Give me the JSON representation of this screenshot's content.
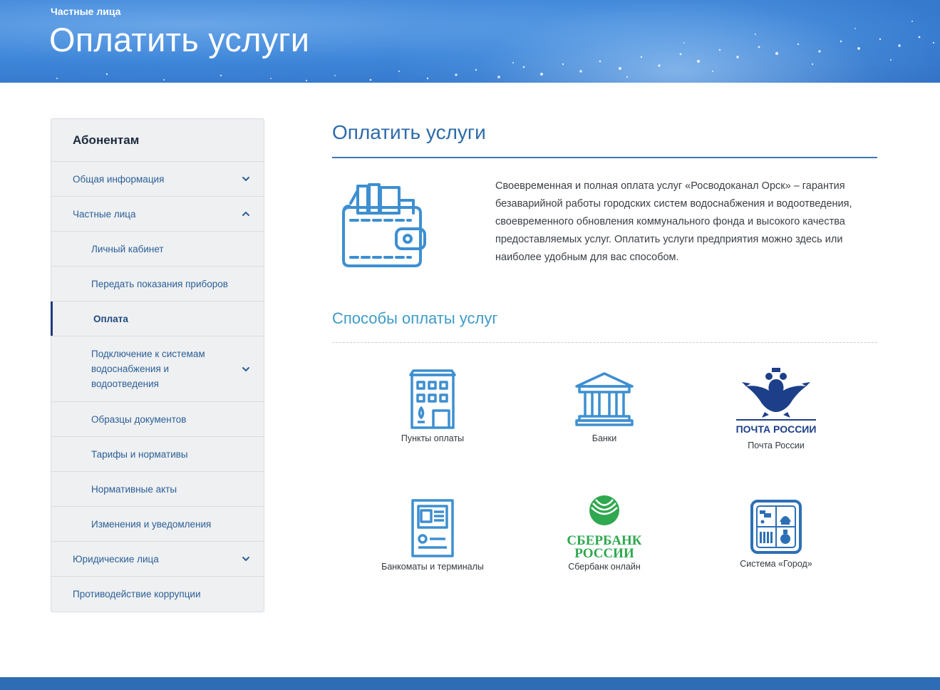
{
  "header": {
    "breadcrumb": "Частные лица",
    "title": "Оплатить услуги"
  },
  "sidebar": {
    "heading": "Абонентам",
    "items": [
      {
        "label": "Общая информация",
        "icon": "chevron-down-icon"
      },
      {
        "label": "Частные лица",
        "icon": "chevron-up-icon"
      },
      {
        "label": "Личный кабинет"
      },
      {
        "label": "Передать показания приборов"
      },
      {
        "label": "Оплата"
      },
      {
        "label": "Подключение к системам водоснабжения и водоотведения",
        "icon": "chevron-down-icon"
      },
      {
        "label": "Образцы документов"
      },
      {
        "label": "Тарифы и нормативы"
      },
      {
        "label": "Нормативные акты"
      },
      {
        "label": "Изменения и уведомления"
      },
      {
        "label": "Юридические лица",
        "icon": "chevron-down-icon"
      },
      {
        "label": "Противодействие коррупции"
      }
    ]
  },
  "main": {
    "title": "Оплатить услуги",
    "intro": "Своевременная и полная оплата услуг «Росводоканал Орск» – гарантия безаварийной работы городских систем водоснабжения и водоотведения, своевременного обновления коммунального фонда и высокого качества предоставляемых услуг. Оплатить услуги предприятия можно здесь или наиболее удобным для вас способом.",
    "methods_title": "Способы оплаты услуг",
    "methods": [
      {
        "label": "Пункты оплаты",
        "icon": "building-icon"
      },
      {
        "label": "Банки",
        "icon": "bank-icon"
      },
      {
        "label": "Почта России",
        "icon": "russian-post-logo",
        "logo_text": "ПОЧТА РОССИИ"
      },
      {
        "label": "Банкоматы и терминалы",
        "icon": "atm-icon"
      },
      {
        "label": "Сбербанк онлайн",
        "icon": "sberbank-logo",
        "logo_text": [
          "СБЕРБАНК",
          "РОССИИ"
        ]
      },
      {
        "label": "Система «Город»",
        "icon": "gorod-system-icon"
      }
    ]
  },
  "colors": {
    "accent": "#2e6ba9",
    "subtitle": "#3f9bc9",
    "icon_blue": "#3d8fd1",
    "banner": "#3e86d9",
    "footer": "#2f6cb6",
    "sber_green": "#2fa84f",
    "post_blue": "#1d3f8a"
  }
}
